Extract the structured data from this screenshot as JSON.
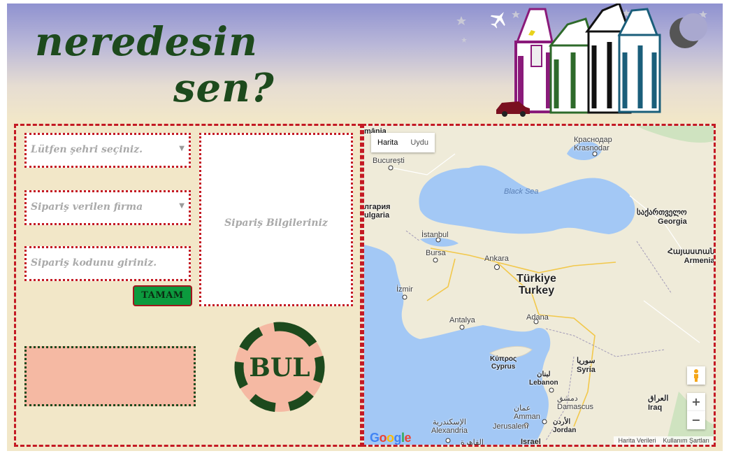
{
  "header": {
    "title_line1": "neredesin",
    "title_line2": "sen?"
  },
  "form": {
    "city_placeholder": "Lütfen şehri seçiniz.",
    "company_placeholder": "Sipariş verilen firma",
    "code_placeholder": "Sipariş kodunu giriniz.",
    "ok_label": "TAMAM",
    "order_info_label": "Sipariş Bilgileriniz",
    "find_label": "BUL"
  },
  "map": {
    "type_map": "Harita",
    "type_satellite": "Uydu",
    "zoom_in": "+",
    "zoom_out": "−",
    "attribution_data": "Harita Verileri",
    "attribution_terms": "Kullanım Şartları",
    "labels": {
      "romania": "mânia",
      "bucharest": "București",
      "krasnodar": "Краснодар\nKrasnodar",
      "black_sea": "Black Sea",
      "bulgaria": "лгария\nulgaria",
      "georgia": "საქართველო\nGeorgia",
      "istanbul": "İstanbul",
      "bursa": "Bursa",
      "ankara": "Ankara",
      "armenia": "Հայաստան\nArmenia",
      "izmir": "İzmir",
      "turkey": "Türkiye\nTurkey",
      "antalya": "Antalya",
      "adana": "Adana",
      "cyprus": "Κύπρος\nCyprus",
      "syria": "سوريا\nSyria",
      "lebanon": "لبنان\nLebanon",
      "damascus": "دمشق\nDamascus",
      "iraq": "العراق\nIraq",
      "alexandria": "الإسكندرية\nAlexandria",
      "jerusalem": "Jerusalem",
      "amman": "عمان\nAmman",
      "jordan": "الأردن\nJordan",
      "israel": "Israel",
      "cairo": "القاهرة"
    }
  },
  "colors": {
    "accent_red": "#c41a24",
    "title_green": "#1d4a1d",
    "ok_green": "#0c9a3e",
    "result_pink": "#f5b9a3",
    "background": "#f2e7c8"
  },
  "icons": [
    "plane-icon",
    "moon-icon",
    "star-icon",
    "car-icon",
    "dropdown-arrow-icon",
    "pegman-icon",
    "google-logo"
  ]
}
